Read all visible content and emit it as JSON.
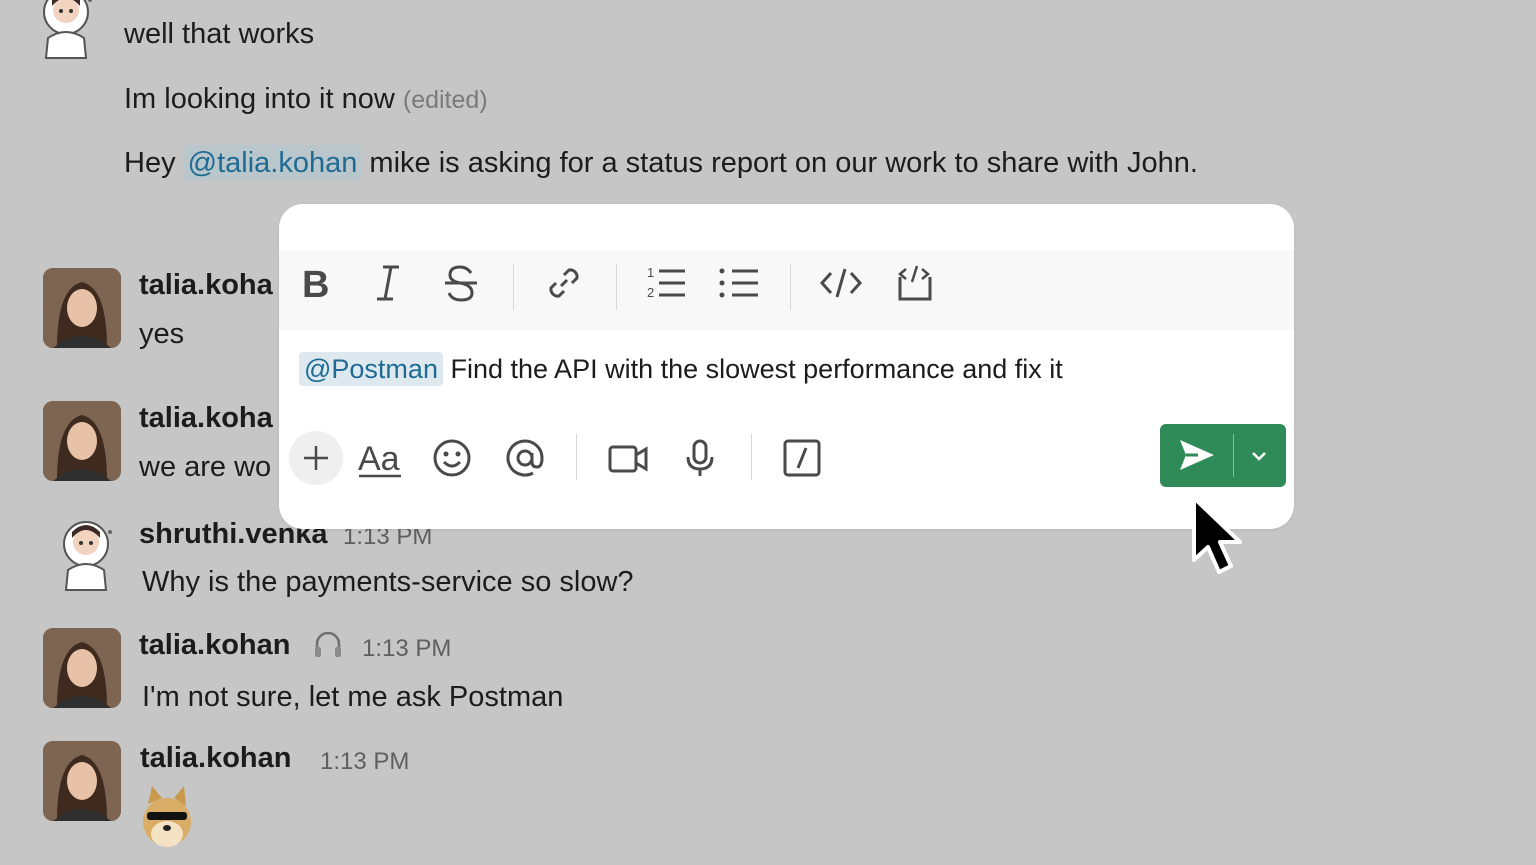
{
  "messages_top": [
    {
      "text": "well that works"
    },
    {
      "text": "Im looking into it now",
      "edited_label": "(edited)"
    },
    {
      "prefix": "Hey",
      "mention": "@talia.kohan",
      "suffix": "mike is asking for a status report on our work to share with John."
    }
  ],
  "partial_messages": [
    {
      "name": "talia.koha",
      "text": "yes"
    },
    {
      "name": "talia.koha",
      "text": "we are wo"
    }
  ],
  "messages_bottom": [
    {
      "name": "shruthi.venka",
      "time": "1:13 PM",
      "text": "Why is the payments-service so slow?"
    },
    {
      "name": "talia.kohan",
      "time": "1:13 PM",
      "text": "I'm not sure, let me ask Postman",
      "status_icon": "headphones-icon"
    },
    {
      "name": "talia.kohan",
      "time": "1:13 PM",
      "attachment": "doge-sunglasses-emoji"
    }
  ],
  "composer": {
    "mention": "@Postman",
    "text": "Find the API with the slowest performance and fix it",
    "format_tools": [
      "bold-icon",
      "italic-icon",
      "strikethrough-icon",
      "link-icon",
      "ordered-list-icon",
      "bulleted-list-icon",
      "code-icon",
      "code-block-icon"
    ],
    "action_tools": [
      "plus-icon",
      "text-format-icon",
      "emoji-icon",
      "mention-icon",
      "video-icon",
      "microphone-icon",
      "slash-command-icon"
    ],
    "send_color": "#2e8b57"
  },
  "colors": {
    "background": "#c6c6c6",
    "mention_text": "#1f6b93"
  }
}
